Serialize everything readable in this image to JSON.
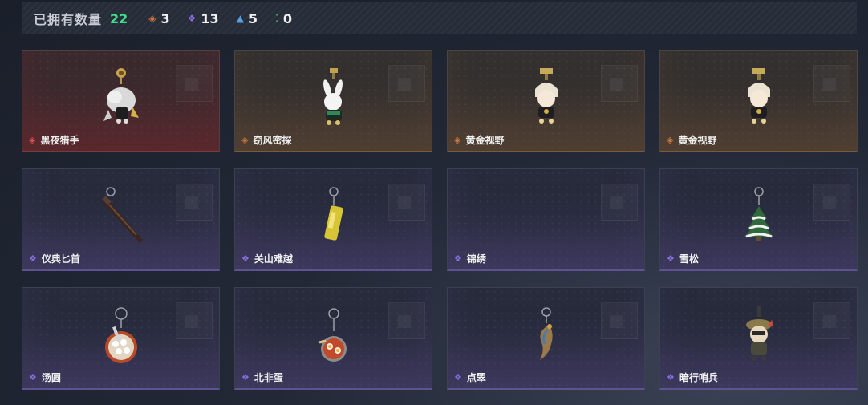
{
  "header": {
    "owned_label": "已拥有数量",
    "owned_count": "22",
    "stats": [
      {
        "icon": "orange-diamond-icon",
        "value": "3",
        "color": "#d07a45"
      },
      {
        "icon": "purple-diamond-icon",
        "value": "13",
        "color": "#8a6ee0"
      },
      {
        "icon": "blue-triangle-icon",
        "value": "5",
        "color": "#5aa0e0"
      },
      {
        "icon": "green-dots-icon",
        "value": "0",
        "color": "#3de08a"
      }
    ]
  },
  "items": [
    {
      "name": "黑夜猎手",
      "rarity": "red",
      "rarity_icon": "red-diamond-icon",
      "icon": "night-hunter-charm-icon"
    },
    {
      "name": "窃风密探",
      "rarity": "gold",
      "rarity_icon": "orange-diamond-icon",
      "icon": "wind-spy-charm-icon"
    },
    {
      "name": "黄金视野",
      "rarity": "gold",
      "rarity_icon": "orange-diamond-icon",
      "icon": "golden-vision-charm-icon"
    },
    {
      "name": "黄金视野",
      "rarity": "gold",
      "rarity_icon": "orange-diamond-icon",
      "icon": "golden-vision-charm-icon"
    },
    {
      "name": "仪典匕首",
      "rarity": "purple",
      "rarity_icon": "purple-diamond-icon",
      "icon": "ceremonial-dagger-charm-icon"
    },
    {
      "name": "关山难越",
      "rarity": "purple",
      "rarity_icon": "purple-diamond-icon",
      "icon": "yellow-cylinder-charm-icon"
    },
    {
      "name": "锦绣",
      "rarity": "purple",
      "rarity_icon": "purple-diamond-icon",
      "icon": "empty-charm-icon"
    },
    {
      "name": "雪松",
      "rarity": "purple",
      "rarity_icon": "purple-diamond-icon",
      "icon": "snow-pine-charm-icon"
    },
    {
      "name": "汤圆",
      "rarity": "purple",
      "rarity_icon": "purple-diamond-icon",
      "icon": "tangyuan-bowl-charm-icon"
    },
    {
      "name": "北非蛋",
      "rarity": "purple",
      "rarity_icon": "purple-diamond-icon",
      "icon": "shakshuka-charm-icon"
    },
    {
      "name": "点翠",
      "rarity": "purple",
      "rarity_icon": "purple-diamond-icon",
      "icon": "phoenix-charm-icon"
    },
    {
      "name": "暗行哨兵",
      "rarity": "purple",
      "rarity_icon": "purple-diamond-icon",
      "icon": "shadow-sentinel-charm-icon"
    }
  ]
}
